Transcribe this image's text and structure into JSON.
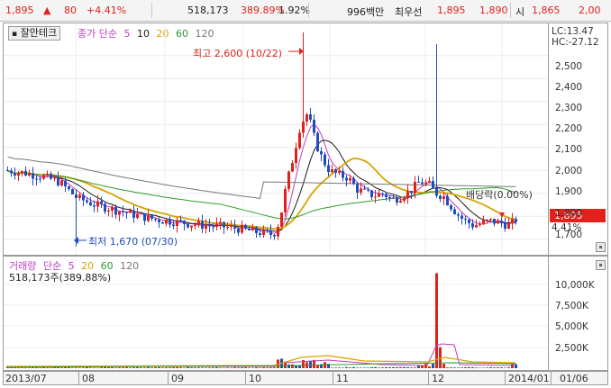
{
  "quote": {
    "price": "1,895",
    "arrow": "▲",
    "change": "80",
    "change_pct": "+4.41%",
    "volume": "518,173",
    "volume_ratio": "389.89%",
    "turnover": "1.92%",
    "amount": "996백만",
    "best_label": "최우선",
    "ask": "1,895",
    "bid": "1,890",
    "open_label": "시",
    "open": "1,865",
    "high": "2,00"
  },
  "toolbar": {
    "tag": "잘만테크"
  },
  "price_legend": {
    "title": "종가 단순",
    "periods": [
      "5",
      "10",
      "20",
      "60",
      "120"
    ],
    "colors": [
      "#c03cc0",
      "#1a1a1a",
      "#d7a400",
      "#2e9a2e",
      "#777777"
    ]
  },
  "price_axis": {
    "lc": "LC:13.47",
    "hc": "HC:-27.12",
    "ticks": [
      "2,500",
      "2,400",
      "2,300",
      "2,200",
      "2,100",
      "2,000",
      "1,900",
      "1,800",
      "1,700"
    ],
    "current": "1,895",
    "current_pct": "4.41%"
  },
  "annotations": {
    "high": "최고 2,600 (10/22)",
    "low": "최저 1,670 (07/30)",
    "dividend": "배당락(0.00%)"
  },
  "volume_legend": {
    "title": "거래량",
    "kind": "단순",
    "periods": [
      "5",
      "20",
      "60",
      "120"
    ],
    "colors": [
      "#c03cc0",
      "#d7a400",
      "#2e9a2e",
      "#777777"
    ],
    "value": "518,173주(389.88%)"
  },
  "volume_axis": {
    "ticks": [
      "10,000K",
      "7,500K",
      "5,000K",
      "2,500K"
    ]
  },
  "x_axis": {
    "labels": [
      "2013/07",
      "08",
      "09",
      "10",
      "11",
      "12",
      "2014/01",
      "01/06"
    ]
  },
  "colors": {
    "up": "#e2211c",
    "down": "#1f4fbf",
    "accent": "#e2211c"
  },
  "chart_data": {
    "type": "candlestick",
    "x": [
      "2013/07",
      "08",
      "09",
      "10",
      "11",
      "12",
      "2014/01"
    ],
    "ylim": [
      1640,
      2640
    ],
    "volume_ylim": [
      0,
      12300000
    ],
    "ohlc_approx": [
      {
        "period": "2013/07",
        "open": 2000,
        "high": 2050,
        "low": 1670,
        "close": 1800
      },
      {
        "period": "08",
        "open": 1800,
        "high": 1880,
        "low": 1740,
        "close": 1780
      },
      {
        "period": "09",
        "open": 1780,
        "high": 1820,
        "low": 1720,
        "close": 1760
      },
      {
        "period": "10",
        "open": 1760,
        "high": 2600,
        "low": 1690,
        "close": 2050
      },
      {
        "period": "11",
        "open": 2050,
        "high": 2100,
        "low": 1850,
        "close": 1900
      },
      {
        "period": "12",
        "open": 1900,
        "high": 2550,
        "low": 1730,
        "close": 1780
      },
      {
        "period": "2014/01",
        "open": 1780,
        "high": 2000,
        "low": 1730,
        "close": 1895
      }
    ],
    "volume_peak": 11800000,
    "series": [
      {
        "name": "5",
        "color": "#c03cc0"
      },
      {
        "name": "10",
        "color": "#1a1a1a"
      },
      {
        "name": "20",
        "color": "#d7a400"
      },
      {
        "name": "60",
        "color": "#2e9a2e"
      },
      {
        "name": "120",
        "color": "#777777"
      }
    ]
  }
}
